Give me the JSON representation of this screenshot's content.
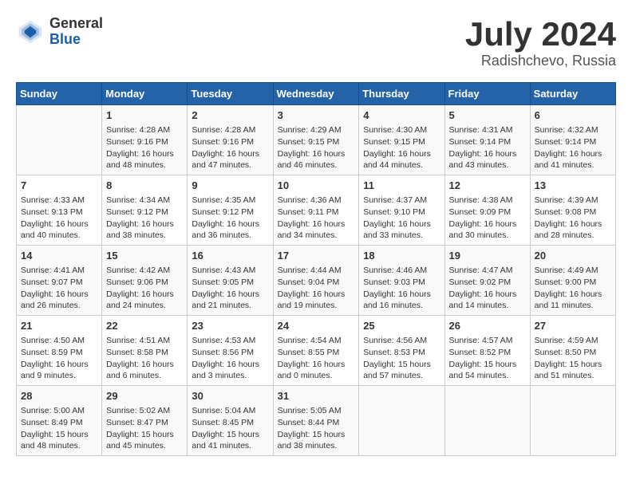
{
  "header": {
    "logo_general": "General",
    "logo_blue": "Blue",
    "title": "July 2024",
    "location": "Radishchevo, Russia"
  },
  "days_of_week": [
    "Sunday",
    "Monday",
    "Tuesday",
    "Wednesday",
    "Thursday",
    "Friday",
    "Saturday"
  ],
  "weeks": [
    [
      {
        "day": "",
        "info": ""
      },
      {
        "day": "1",
        "info": "Sunrise: 4:28 AM\nSunset: 9:16 PM\nDaylight: 16 hours\nand 48 minutes."
      },
      {
        "day": "2",
        "info": "Sunrise: 4:28 AM\nSunset: 9:16 PM\nDaylight: 16 hours\nand 47 minutes."
      },
      {
        "day": "3",
        "info": "Sunrise: 4:29 AM\nSunset: 9:15 PM\nDaylight: 16 hours\nand 46 minutes."
      },
      {
        "day": "4",
        "info": "Sunrise: 4:30 AM\nSunset: 9:15 PM\nDaylight: 16 hours\nand 44 minutes."
      },
      {
        "day": "5",
        "info": "Sunrise: 4:31 AM\nSunset: 9:14 PM\nDaylight: 16 hours\nand 43 minutes."
      },
      {
        "day": "6",
        "info": "Sunrise: 4:32 AM\nSunset: 9:14 PM\nDaylight: 16 hours\nand 41 minutes."
      }
    ],
    [
      {
        "day": "7",
        "info": "Sunrise: 4:33 AM\nSunset: 9:13 PM\nDaylight: 16 hours\nand 40 minutes."
      },
      {
        "day": "8",
        "info": "Sunrise: 4:34 AM\nSunset: 9:12 PM\nDaylight: 16 hours\nand 38 minutes."
      },
      {
        "day": "9",
        "info": "Sunrise: 4:35 AM\nSunset: 9:12 PM\nDaylight: 16 hours\nand 36 minutes."
      },
      {
        "day": "10",
        "info": "Sunrise: 4:36 AM\nSunset: 9:11 PM\nDaylight: 16 hours\nand 34 minutes."
      },
      {
        "day": "11",
        "info": "Sunrise: 4:37 AM\nSunset: 9:10 PM\nDaylight: 16 hours\nand 33 minutes."
      },
      {
        "day": "12",
        "info": "Sunrise: 4:38 AM\nSunset: 9:09 PM\nDaylight: 16 hours\nand 30 minutes."
      },
      {
        "day": "13",
        "info": "Sunrise: 4:39 AM\nSunset: 9:08 PM\nDaylight: 16 hours\nand 28 minutes."
      }
    ],
    [
      {
        "day": "14",
        "info": "Sunrise: 4:41 AM\nSunset: 9:07 PM\nDaylight: 16 hours\nand 26 minutes."
      },
      {
        "day": "15",
        "info": "Sunrise: 4:42 AM\nSunset: 9:06 PM\nDaylight: 16 hours\nand 24 minutes."
      },
      {
        "day": "16",
        "info": "Sunrise: 4:43 AM\nSunset: 9:05 PM\nDaylight: 16 hours\nand 21 minutes."
      },
      {
        "day": "17",
        "info": "Sunrise: 4:44 AM\nSunset: 9:04 PM\nDaylight: 16 hours\nand 19 minutes."
      },
      {
        "day": "18",
        "info": "Sunrise: 4:46 AM\nSunset: 9:03 PM\nDaylight: 16 hours\nand 16 minutes."
      },
      {
        "day": "19",
        "info": "Sunrise: 4:47 AM\nSunset: 9:02 PM\nDaylight: 16 hours\nand 14 minutes."
      },
      {
        "day": "20",
        "info": "Sunrise: 4:49 AM\nSunset: 9:00 PM\nDaylight: 16 hours\nand 11 minutes."
      }
    ],
    [
      {
        "day": "21",
        "info": "Sunrise: 4:50 AM\nSunset: 8:59 PM\nDaylight: 16 hours\nand 9 minutes."
      },
      {
        "day": "22",
        "info": "Sunrise: 4:51 AM\nSunset: 8:58 PM\nDaylight: 16 hours\nand 6 minutes."
      },
      {
        "day": "23",
        "info": "Sunrise: 4:53 AM\nSunset: 8:56 PM\nDaylight: 16 hours\nand 3 minutes."
      },
      {
        "day": "24",
        "info": "Sunrise: 4:54 AM\nSunset: 8:55 PM\nDaylight: 16 hours\nand 0 minutes."
      },
      {
        "day": "25",
        "info": "Sunrise: 4:56 AM\nSunset: 8:53 PM\nDaylight: 15 hours\nand 57 minutes."
      },
      {
        "day": "26",
        "info": "Sunrise: 4:57 AM\nSunset: 8:52 PM\nDaylight: 15 hours\nand 54 minutes."
      },
      {
        "day": "27",
        "info": "Sunrise: 4:59 AM\nSunset: 8:50 PM\nDaylight: 15 hours\nand 51 minutes."
      }
    ],
    [
      {
        "day": "28",
        "info": "Sunrise: 5:00 AM\nSunset: 8:49 PM\nDaylight: 15 hours\nand 48 minutes."
      },
      {
        "day": "29",
        "info": "Sunrise: 5:02 AM\nSunset: 8:47 PM\nDaylight: 15 hours\nand 45 minutes."
      },
      {
        "day": "30",
        "info": "Sunrise: 5:04 AM\nSunset: 8:45 PM\nDaylight: 15 hours\nand 41 minutes."
      },
      {
        "day": "31",
        "info": "Sunrise: 5:05 AM\nSunset: 8:44 PM\nDaylight: 15 hours\nand 38 minutes."
      },
      {
        "day": "",
        "info": ""
      },
      {
        "day": "",
        "info": ""
      },
      {
        "day": "",
        "info": ""
      }
    ]
  ]
}
